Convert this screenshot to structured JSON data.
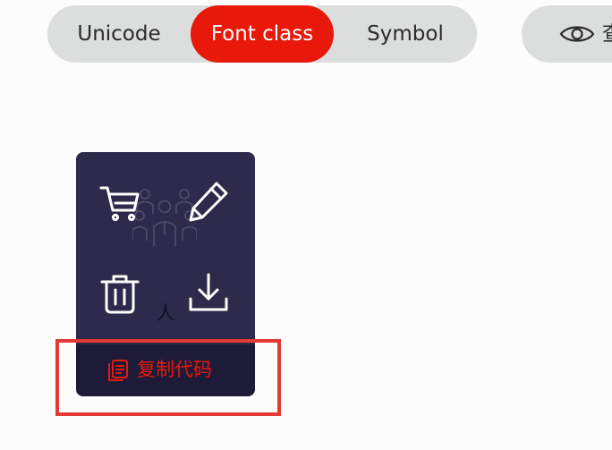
{
  "tabs": [
    {
      "label": "Unicode",
      "active": false
    },
    {
      "label": "Font class",
      "active": true
    },
    {
      "label": "Symbol",
      "active": false
    }
  ],
  "view_button": {
    "icon": "eye-icon",
    "label": "查"
  },
  "icon_card": {
    "background_icon": "people-group-icon",
    "caption": "人",
    "icons": [
      "cart-icon",
      "pencil-icon",
      "trash-icon",
      "download-icon"
    ],
    "copy_icon": "copy-icon",
    "copy_label": "复制代码"
  },
  "colors": {
    "accent": "#e8180a",
    "card_bg": "#2d2a4b",
    "copy_bar_bg": "#1e1b39",
    "tab_bg": "#dcdddd",
    "highlight": "#e53935"
  }
}
